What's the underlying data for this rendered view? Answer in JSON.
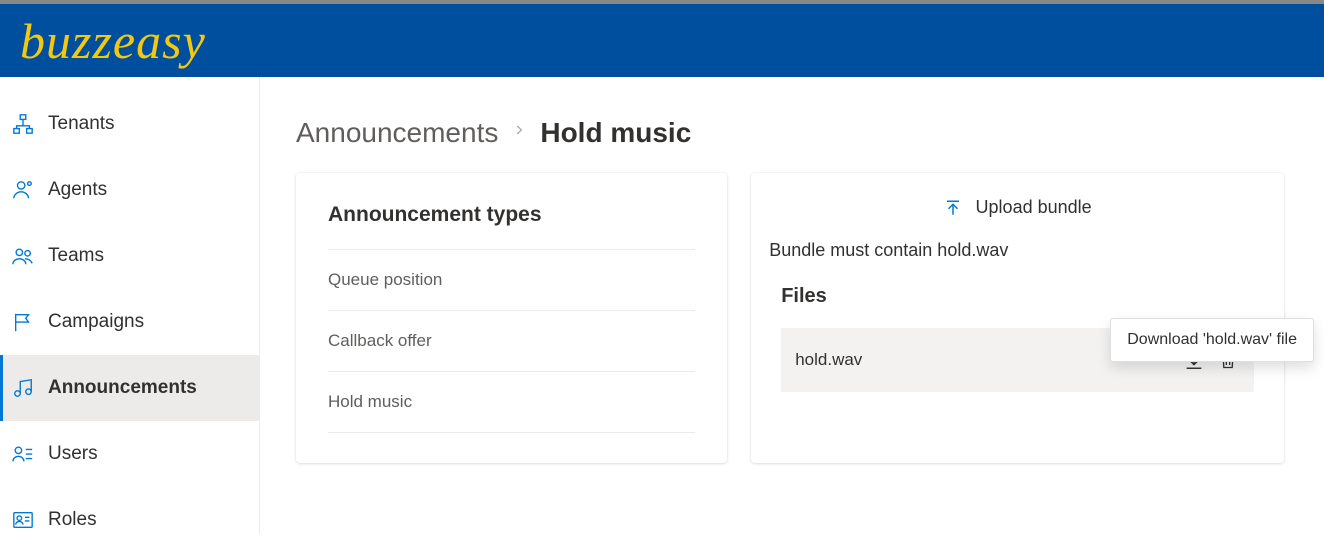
{
  "header": {
    "logo_text": "buzzeasy"
  },
  "sidebar": {
    "items": [
      {
        "label": "Tenants",
        "icon": "sitemap-icon",
        "active": false
      },
      {
        "label": "Agents",
        "icon": "person-icon",
        "active": false
      },
      {
        "label": "Teams",
        "icon": "people-icon",
        "active": false
      },
      {
        "label": "Campaigns",
        "icon": "flag-icon",
        "active": false
      },
      {
        "label": "Announcements",
        "icon": "music-icon",
        "active": true
      },
      {
        "label": "Users",
        "icon": "user-list-icon",
        "active": false
      },
      {
        "label": "Roles",
        "icon": "profile-icon",
        "active": false
      }
    ]
  },
  "breadcrumb": {
    "parent": "Announcements",
    "current": "Hold music"
  },
  "types_card": {
    "title": "Announcement types",
    "items": [
      "Queue position",
      "Callback offer",
      "Hold music"
    ]
  },
  "upload_card": {
    "upload_label": "Upload bundle",
    "note": "Bundle must contain hold.wav",
    "files_title": "Files",
    "files": [
      {
        "name": "hold.wav"
      }
    ],
    "tooltip": "Download 'hold.wav' file"
  }
}
